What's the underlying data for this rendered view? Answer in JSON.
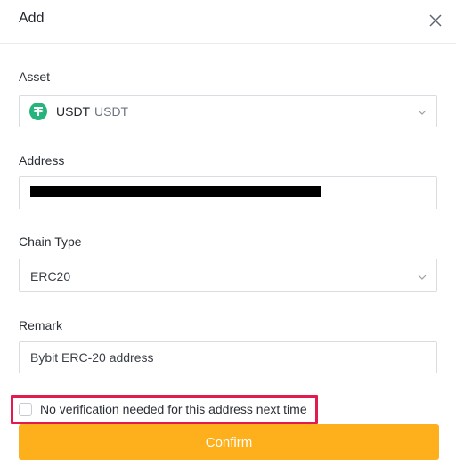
{
  "dialog": {
    "title": "Add"
  },
  "asset": {
    "label": "Asset",
    "symbol": "USDT",
    "name": "USDT",
    "icon": "tether-coin-icon",
    "icon_color": "#26b47d"
  },
  "address": {
    "label": "Address",
    "value_redacted": true
  },
  "chain_type": {
    "label": "Chain Type",
    "value": "ERC20"
  },
  "remark": {
    "label": "Remark",
    "value": "Bybit ERC-20 address"
  },
  "verification": {
    "label": "No verification needed for this address next time",
    "checked": false,
    "highlight_color": "#e21a4e"
  },
  "actions": {
    "confirm_label": "Confirm",
    "confirm_color": "#fdaf1c"
  }
}
